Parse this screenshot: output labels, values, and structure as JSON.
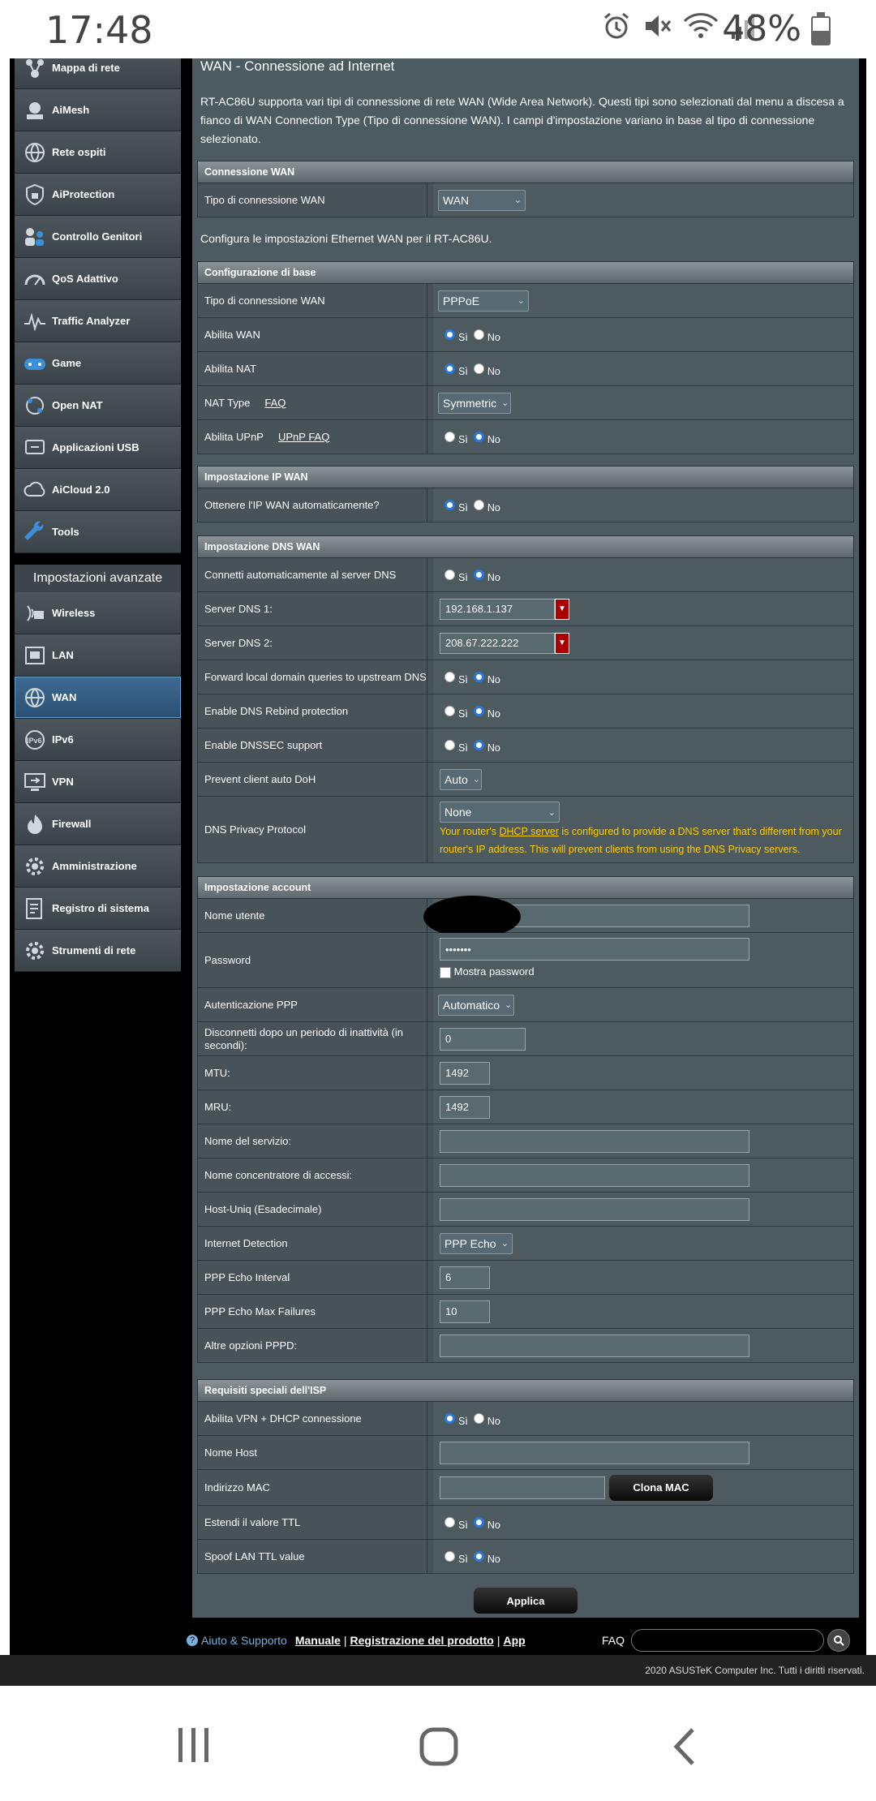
{
  "status": {
    "time": "17:48",
    "battery": "48%"
  },
  "sidebar": {
    "items": [
      {
        "label": "Mappa di rete",
        "icon": "network-map-icon"
      },
      {
        "label": "AiMesh",
        "icon": "aimesh-icon"
      },
      {
        "label": "Rete ospiti",
        "icon": "guest-network-icon"
      },
      {
        "label": "AiProtection",
        "icon": "shield-icon"
      },
      {
        "label": "Controllo Genitori",
        "icon": "parental-control-icon"
      },
      {
        "label": "QoS Adattivo",
        "icon": "gauge-icon"
      },
      {
        "label": "Traffic Analyzer",
        "icon": "traffic-icon"
      },
      {
        "label": "Game",
        "icon": "gamepad-icon"
      },
      {
        "label": "Open NAT",
        "icon": "open-nat-icon"
      },
      {
        "label": "Applicazioni USB",
        "icon": "usb-icon"
      },
      {
        "label": "AiCloud 2.0",
        "icon": "cloud-icon"
      },
      {
        "label": "Tools",
        "icon": "wrench-icon"
      }
    ],
    "advanced_title": "Impostazioni avanzate",
    "advanced": [
      {
        "label": "Wireless",
        "icon": "wireless-icon"
      },
      {
        "label": "LAN",
        "icon": "lan-icon"
      },
      {
        "label": "WAN",
        "icon": "globe-icon"
      },
      {
        "label": "IPv6",
        "icon": "ipv6-icon"
      },
      {
        "label": "VPN",
        "icon": "vpn-icon"
      },
      {
        "label": "Firewall",
        "icon": "firewall-icon"
      },
      {
        "label": "Amministrazione",
        "icon": "gear-icon"
      },
      {
        "label": "Registro di sistema",
        "icon": "log-icon"
      },
      {
        "label": "Strumenti di rete",
        "icon": "gear-icon"
      }
    ]
  },
  "main": {
    "title": "WAN - Connessione ad Internet",
    "intro": "RT-AC86U supporta vari tipi di connessione di rete WAN (Wide Area Network). Questi tipi sono selezionati dal menu a discesa a fianco di WAN Connection Type (Tipo di connessione WAN). I campi d'impostazione variano in base al tipo di connessione selezionato.",
    "sec_wan_conn": "Connessione WAN",
    "wan_conn_type_label": "Tipo di connessione WAN",
    "wan_conn_type_value": "WAN",
    "config_text": "Configura le impostazioni Ethernet WAN per il RT-AC86U.",
    "sec_basic": "Configurazione di base",
    "basic_type_label": "Tipo di connessione WAN",
    "basic_type_value": "PPPoE",
    "enable_wan_label": "Abilita WAN",
    "enable_nat_label": "Abilita NAT",
    "nat_type_label": "NAT Type",
    "faq": "FAQ",
    "nat_type_value": "Symmetric",
    "upnp_label": "Abilita UPnP",
    "upnp_faq": "UPnP FAQ",
    "sec_ip": "Impostazione IP WAN",
    "auto_ip_label": "Ottenere l'IP WAN automaticamente?",
    "sec_dns": "Impostazione DNS WAN",
    "dns_auto_label": "Connetti automaticamente al server DNS",
    "dns1_label": "Server DNS 1:",
    "dns1_value": "192.168.1.137",
    "dns2_label": "Server DNS 2:",
    "dns2_value": "208.67.222.222",
    "forward_label": "Forward local domain queries to upstream DNS",
    "rebind_label": "Enable DNS Rebind protection",
    "dnssec_label": "Enable DNSSEC support",
    "doh_label": "Prevent client auto DoH",
    "doh_value": "Auto",
    "privacy_label": "DNS Privacy Protocol",
    "privacy_value": "None",
    "privacy_warn_pre": "Your router's ",
    "privacy_warn_link": "DHCP server",
    "privacy_warn_post": " is configured to provide a DNS server that's different from your router's IP address. This will prevent clients from using the DNS Privacy servers.",
    "sec_account": "Impostazione account",
    "username_label": "Nome utente",
    "password_label": "Password",
    "password_value": "•••••••",
    "show_password": "Mostra password",
    "ppp_auth_label": "Autenticazione PPP",
    "ppp_auth_value": "Automatico",
    "idle_label": "Disconnetti dopo un periodo di inattività (in secondi):",
    "idle_value": "0",
    "mtu_label": "MTU:",
    "mtu_value": "1492",
    "mru_label": "MRU:",
    "mru_value": "1492",
    "service_label": "Nome del servizio:",
    "concentrator_label": "Nome concentratore di accessi:",
    "hostuniq_label": "Host-Uniq (Esadecimale)",
    "detect_label": "Internet Detection",
    "detect_value": "PPP Echo",
    "echo_interval_label": "PPP Echo Interval",
    "echo_interval_value": "6",
    "echo_fail_label": "PPP Echo Max Failures",
    "echo_fail_value": "10",
    "pppd_label": "Altre opzioni PPPD:",
    "sec_isp": "Requisiti speciali dell'ISP",
    "vpn_dhcp_label": "Abilita VPN + DHCP connessione",
    "hostname_label": "Nome Host",
    "mac_label": "Indirizzo MAC",
    "clone_mac": "Clona MAC",
    "ttl_label": "Estendi il valore TTL",
    "spoof_label": "Spoof LAN TTL value",
    "yes": "Sì",
    "no": "No",
    "apply": "Applica"
  },
  "footer": {
    "help": "Aiuto & Supporto",
    "manual": "Manuale",
    "sep": "|",
    "register": "Registrazione del prodotto",
    "app": "App",
    "faq": "FAQ",
    "copyright": "2020 ASUSTeK Computer Inc. Tutti i diritti riservati."
  }
}
